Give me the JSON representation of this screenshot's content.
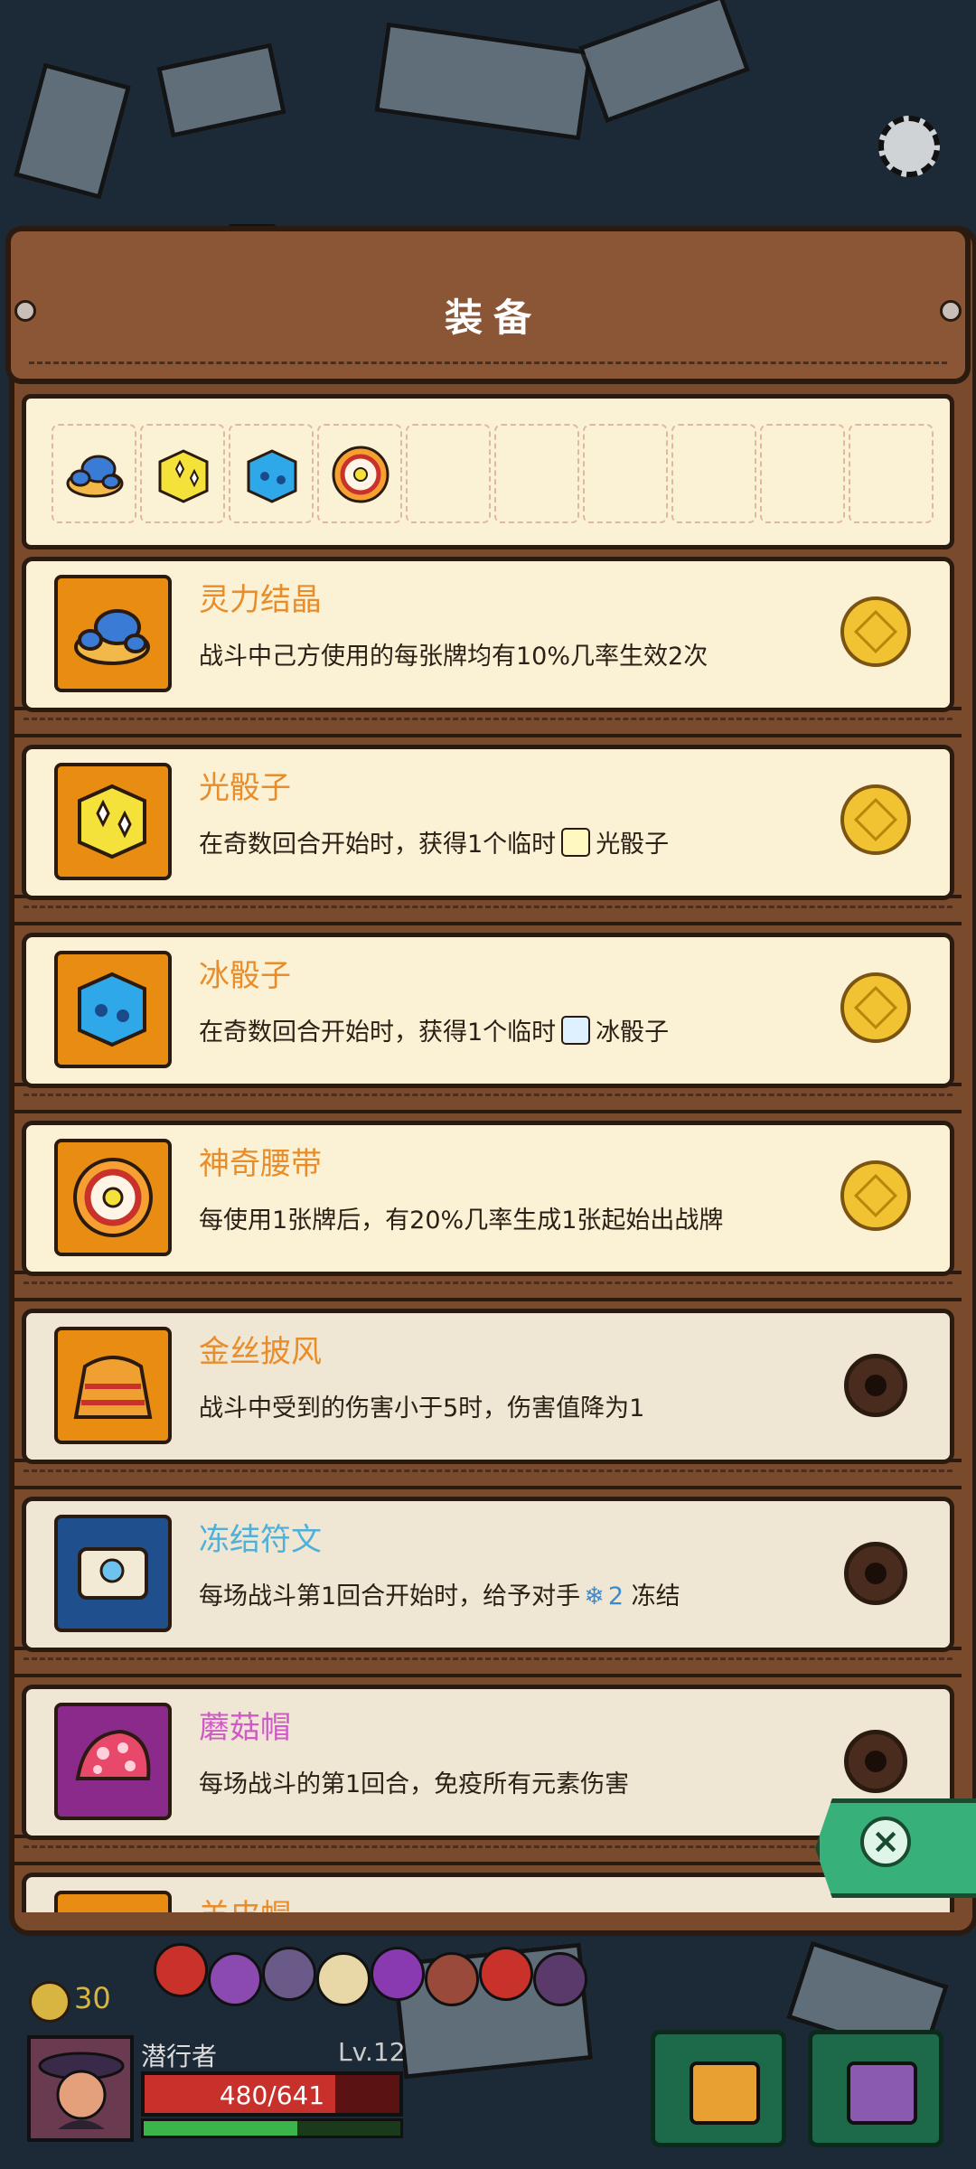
{
  "panel": {
    "title": "装备",
    "equipped_slots": [
      "crystal-icon",
      "light-dice-icon",
      "ice-dice-icon",
      "belt-icon",
      "",
      "",
      "",
      "",
      "",
      ""
    ]
  },
  "items": [
    {
      "name": "灵力结晶",
      "desc": "战斗中己方使用的每张牌均有10%几率生效2次",
      "status": "owned"
    },
    {
      "name": "光骰子",
      "desc_before": "在奇数回合开始时，获得1个临时",
      "desc_after": "光骰子",
      "status": "owned"
    },
    {
      "name": "冰骰子",
      "desc_before": "在奇数回合开始时，获得1个临时",
      "desc_after": "冰骰子",
      "status": "owned"
    },
    {
      "name": "神奇腰带",
      "desc": "每使用1张牌后，有20%几率生成1张起始出战牌",
      "status": "owned"
    },
    {
      "name": "金丝披风",
      "desc": "战斗中受到的伤害小于5时，伤害值降为1",
      "status": "locked"
    },
    {
      "name": "冻结符文",
      "desc_before": "每场战斗第1回合开始时，给予对手",
      "freeze_amount": "2",
      "desc_after": "冻结",
      "status": "locked"
    },
    {
      "name": "蘑菇帽",
      "desc": "每场战斗的第1回合，免疫所有元素伤害",
      "status": "locked"
    },
    {
      "name": "羊皮帽",
      "desc": "",
      "status": "locked"
    }
  ],
  "player": {
    "gold": "30",
    "name": "潜行者",
    "level": "Lv.12",
    "hp_text": "480/641",
    "hp_fraction": 0.749,
    "xp_fraction": 0.6
  },
  "colors": {
    "accent_orange": "#e88d2a",
    "accent_cyan": "#4fb0d8",
    "accent_pink": "#d05ac8",
    "close_green": "#37b07a"
  }
}
